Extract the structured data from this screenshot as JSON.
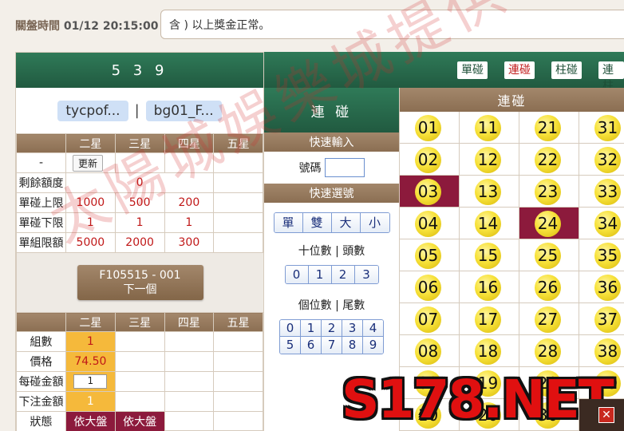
{
  "header": {
    "close_time_label": "關盤時間",
    "close_time_value": "01/12 20:15:00",
    "marquee": "含 ) 以上獎金正常。"
  },
  "game": {
    "name": "5 3 9",
    "accounts": [
      "tycpof...",
      "bg01_F..."
    ],
    "separator": "|"
  },
  "limits_table": {
    "columns": [
      "二星",
      "三星",
      "四星",
      "五星"
    ],
    "update_row_label": "-",
    "update_button": "更新",
    "rows": [
      {
        "label": "剩餘額度",
        "merged_value": "0"
      },
      {
        "label": "單碰上限",
        "values": [
          "1000",
          "500",
          "200",
          ""
        ]
      },
      {
        "label": "單碰下限",
        "values": [
          "1",
          "1",
          "1",
          ""
        ]
      },
      {
        "label": "單組限額",
        "values": [
          "5000",
          "2000",
          "300",
          ""
        ]
      }
    ]
  },
  "next_button": {
    "line1": "F105515 - 001",
    "line2": "下一個"
  },
  "bet_table": {
    "columns": [
      "二星",
      "三星",
      "四星",
      "五星"
    ],
    "rows": [
      {
        "label": "組數",
        "value": "1"
      },
      {
        "label": "價格",
        "value": "74.50"
      },
      {
        "label": "每碰金額",
        "input": "1"
      },
      {
        "label": "下注金額",
        "value": "1"
      },
      {
        "label": "狀態",
        "values": [
          "依大盤",
          "依大盤"
        ]
      }
    ]
  },
  "mode_tabs": [
    {
      "label": "單碰",
      "active": false
    },
    {
      "label": "連碰",
      "active": true
    },
    {
      "label": "柱碰",
      "active": false
    },
    {
      "label": "連柱",
      "active": false
    }
  ],
  "quick_panel": {
    "title": "連 碰",
    "quick_input_label": "快速輸入",
    "number_label": "號碼",
    "quick_select_label": "快速選號",
    "size_buttons": [
      "單",
      "雙",
      "大",
      "小"
    ],
    "tens_caption": "十位數 | 頭數",
    "tens_buttons": [
      "0",
      "1",
      "2",
      "3"
    ],
    "units_caption": "個位數 | 尾數",
    "units_buttons": [
      "0",
      "1",
      "2",
      "3",
      "4",
      "5",
      "6",
      "7",
      "8",
      "9"
    ]
  },
  "number_grid": {
    "title": "連碰",
    "columns": [
      [
        "01",
        "02",
        "03",
        "04",
        "05",
        "06",
        "07",
        "08",
        "09",
        "10"
      ],
      [
        "11",
        "12",
        "13",
        "14",
        "15",
        "16",
        "17",
        "18",
        "19",
        "20"
      ],
      [
        "21",
        "22",
        "23",
        "24",
        "25",
        "26",
        "27",
        "28",
        "29",
        "30"
      ],
      [
        "31",
        "32",
        "33",
        "34",
        "35",
        "36",
        "37",
        "38",
        "39"
      ]
    ],
    "selected": [
      "03",
      "24"
    ]
  },
  "watermark": "太陽城娛樂城提供",
  "ad": {
    "text": "S178.NET",
    "close": "✕"
  },
  "colors": {
    "green": "#215a40",
    "brown": "#8b6e52",
    "selected": "#8c1a3c",
    "highlight": "#f5b93b"
  }
}
